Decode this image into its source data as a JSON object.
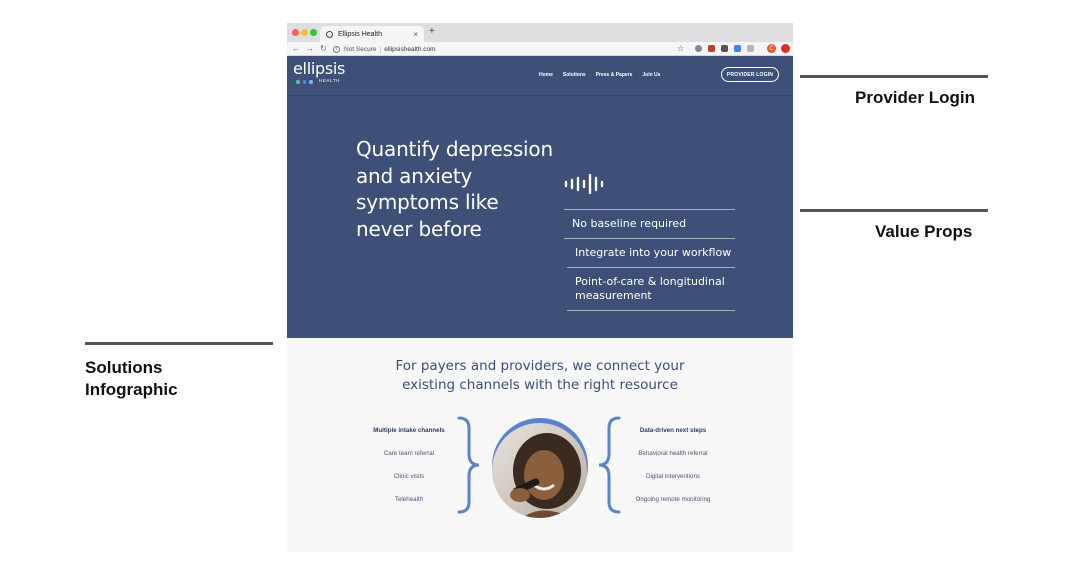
{
  "browser": {
    "tab_title": "Ellipsis Health",
    "tab_close": "×",
    "new_tab": "+",
    "security": "Not Secure",
    "url": "ellipsishealth.com"
  },
  "site": {
    "logo_word": "ellipsis",
    "logo_sub": "HEALTH",
    "nav": [
      "Home",
      "Solutions",
      "Press & Papers",
      "Join Us"
    ],
    "login_label": "PROVIDER LOGIN",
    "headline": "Quantify depression and anxiety symptoms like never before",
    "value_props": [
      "No baseline required",
      "Integrate into your workflow",
      "Point-of-care & longitudinal measurement"
    ],
    "solutions_title_line1": "For payers and providers, we connect your",
    "solutions_title_line2": "existing channels with the right resource",
    "left_heading": "Multiple intake channels",
    "left_items": [
      "Care team referral",
      "Clinic visits",
      "Telehealth"
    ],
    "right_heading": "Data-driven next steps",
    "right_items": [
      "Behavioral health referral",
      "Digital interventions",
      "Ongoing remote monitoring"
    ]
  },
  "annotations": {
    "provider_login": "Provider Login",
    "value_props": "Value Props",
    "solutions_line1": "Solutions",
    "solutions_line2": "Infographic"
  },
  "colors": {
    "hero_bg": "#3e5078",
    "accent_blue": "#5a84c9",
    "title_blue": "#3c4e78",
    "logo_dots": [
      "#4fc3a1",
      "#4a90e2",
      "#7fb2ee"
    ]
  }
}
